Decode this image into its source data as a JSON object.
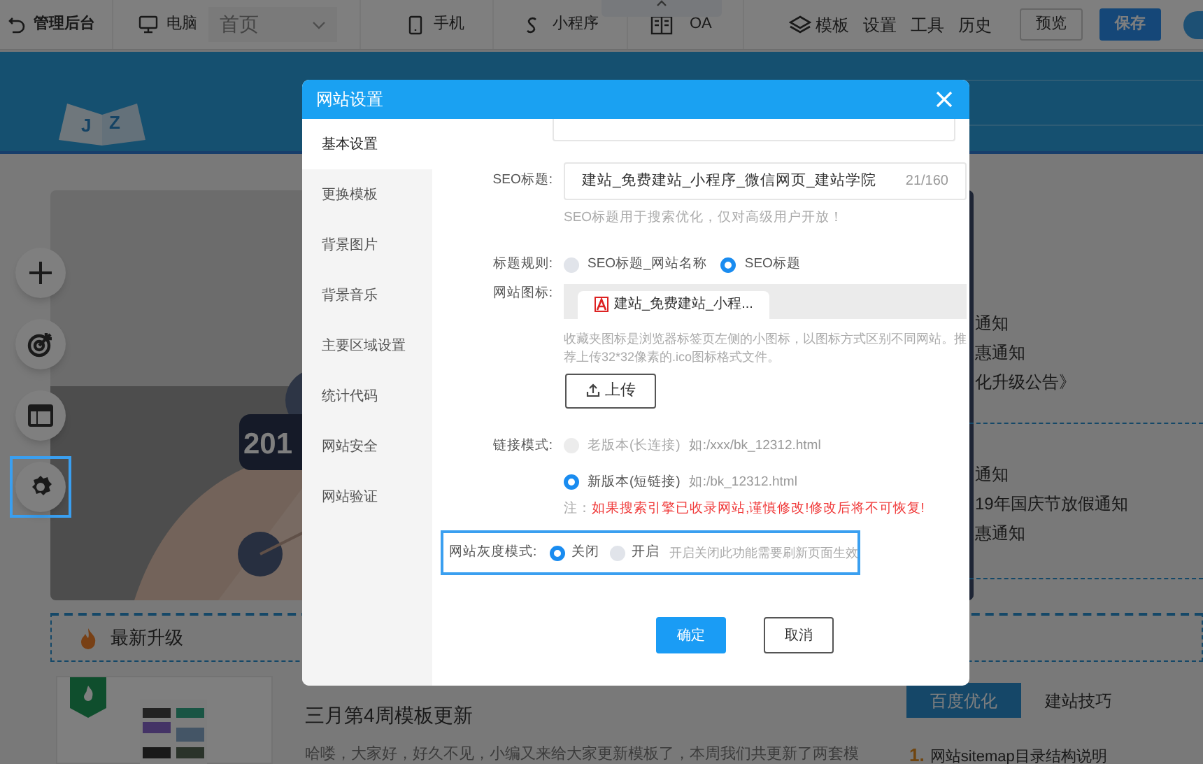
{
  "toolbar": {
    "admin": "管理后台",
    "desktop": "电脑",
    "page_select": {
      "value": "首页"
    },
    "mobile": "手机",
    "mini_program": "小程序",
    "oa": "OA",
    "menu": [
      {
        "label": "模板",
        "kind": "layers"
      },
      {
        "label": "设置",
        "kind": "text"
      },
      {
        "label": "工具",
        "kind": "text"
      },
      {
        "label": "历史",
        "kind": "text"
      }
    ],
    "preview": "预览",
    "save": "保存"
  },
  "header": {
    "logo_letters": [
      "J",
      "Z"
    ]
  },
  "side_tools": [
    {
      "kind": "add",
      "selected": false
    },
    {
      "kind": "target",
      "selected": false
    },
    {
      "kind": "layout",
      "selected": false
    },
    {
      "kind": "settings",
      "selected": true
    }
  ],
  "banner": {
    "kind": "picture",
    "caption": "201"
  },
  "news_snippets": [
    "通知",
    "惠通知",
    "化升级公告》",
    "通知",
    "19年国庆节放假通知",
    "惠通知"
  ],
  "update_bar": {
    "label": "最新升级"
  },
  "article": {
    "title": "三月第4周模板更新",
    "excerpt": "哈喽，大家好，好久不见，小编又来给大家更新模板了，本周我们共更新了两套模"
  },
  "side_tabs": [
    {
      "label": "百度优化",
      "selected": true
    },
    {
      "label": "建站技巧",
      "selected": false
    }
  ],
  "side_list": [
    {
      "number": "1.",
      "text": "网站sitemap目录结构说明"
    }
  ],
  "dialog": {
    "title": "网站设置",
    "nav": [
      {
        "label": "基本设置",
        "selected": true
      },
      {
        "label": "更换模板",
        "selected": false
      },
      {
        "label": "背景图片",
        "selected": false
      },
      {
        "label": "背景音乐",
        "selected": false
      },
      {
        "label": "主要区域设置",
        "selected": false
      },
      {
        "label": "统计代码",
        "selected": false
      },
      {
        "label": "网站安全",
        "selected": false
      },
      {
        "label": "网站验证",
        "selected": false
      }
    ],
    "seo_title": {
      "label": "SEO标题:",
      "value": "建站_免费建站_小程序_微信网页_建站学院",
      "counter": "21/160",
      "hint": "SEO标题用于搜索优化，仅对高级用户开放！"
    },
    "title_rule": {
      "label": "标题规则:",
      "options": [
        {
          "label": "SEO标题_网站名称",
          "selected": false
        },
        {
          "label": "SEO标题",
          "selected": true
        }
      ]
    },
    "favicon": {
      "label": "网站图标:",
      "file": "建站_免费建站_小程...",
      "hint": "收藏夹图标是浏览器标签页左侧的小图标，以图标方式区别不同网站。推荐上传32*32像素的.ico图标格式文件。",
      "upload": "上传"
    },
    "link_mode": {
      "label": "链接模式:",
      "options": [
        {
          "label": "老版本(长连接)",
          "example": "如:/xxx/bk_12312.html",
          "selected": false,
          "disabled": true
        },
        {
          "label": "新版本(短链接)",
          "example": "如:/bk_12312.html",
          "selected": true,
          "disabled": false
        }
      ],
      "note_label": "注：",
      "note": "如果搜索引擎已收录网站,谨慎修改!修改后将不可恢复!"
    },
    "gray_mode": {
      "label": "网站灰度模式:",
      "highlighted": true,
      "options": [
        {
          "label": "关闭",
          "selected": true
        },
        {
          "label": "开启",
          "selected": false
        }
      ],
      "hint": "开启关闭此功能需要刷新页面生效"
    },
    "buttons": [
      {
        "label": "确定",
        "kind": "primary"
      },
      {
        "label": "取消",
        "kind": "default"
      }
    ]
  }
}
